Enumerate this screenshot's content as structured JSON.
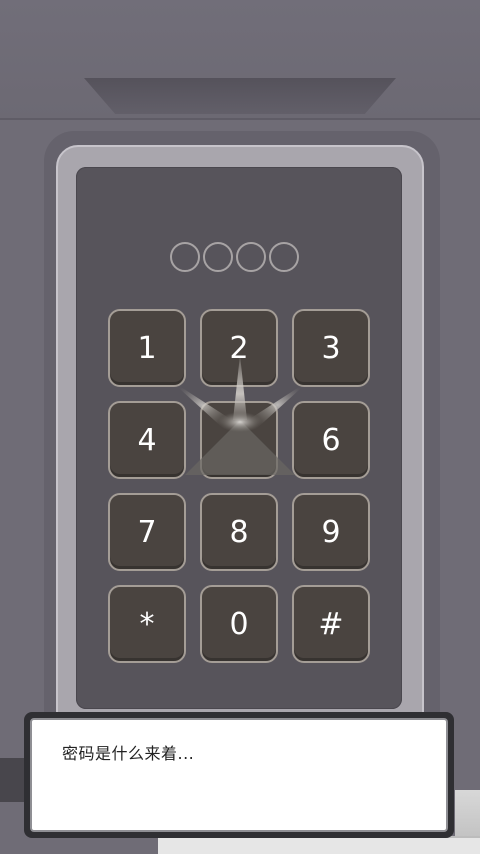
{
  "keypad": {
    "pin_slots": 4,
    "keys": [
      "1",
      "2",
      "3",
      "4",
      "5",
      "6",
      "7",
      "8",
      "9",
      "*",
      "0",
      "#"
    ]
  },
  "dialog": {
    "text": "密码是什么来着..."
  }
}
